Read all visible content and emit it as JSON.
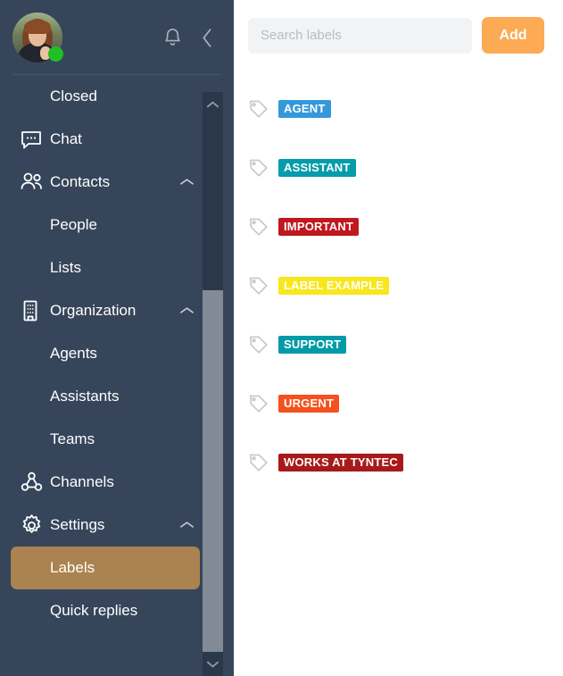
{
  "sidebar": {
    "avatar": {
      "name": "user-avatar",
      "status": "online"
    },
    "header_icons": [
      {
        "name": "notifications-bell-icon",
        "glyph": "bell"
      },
      {
        "name": "collapse-sidebar-icon",
        "glyph": "chevron-left"
      }
    ],
    "items": [
      {
        "label": "Closed",
        "icon": "none",
        "level": "sub",
        "chevron": "",
        "active": false
      },
      {
        "label": "Chat",
        "icon": "chat-icon",
        "level": "top",
        "chevron": "",
        "active": false
      },
      {
        "label": "Contacts",
        "icon": "contacts-icon",
        "level": "top",
        "chevron": "up",
        "active": false
      },
      {
        "label": "People",
        "icon": "none",
        "level": "sub",
        "chevron": "",
        "active": false
      },
      {
        "label": "Lists",
        "icon": "none",
        "level": "sub",
        "chevron": "",
        "active": false
      },
      {
        "label": "Organization",
        "icon": "building-icon",
        "level": "top",
        "chevron": "up",
        "active": false
      },
      {
        "label": "Agents",
        "icon": "none",
        "level": "sub",
        "chevron": "",
        "active": false
      },
      {
        "label": "Assistants",
        "icon": "none",
        "level": "sub",
        "chevron": "",
        "active": false
      },
      {
        "label": "Teams",
        "icon": "none",
        "level": "sub",
        "chevron": "",
        "active": false
      },
      {
        "label": "Channels",
        "icon": "channels-icon",
        "level": "top",
        "chevron": "",
        "active": false
      },
      {
        "label": "Settings",
        "icon": "gear-icon",
        "level": "top",
        "chevron": "up",
        "active": false
      },
      {
        "label": "Labels",
        "icon": "none",
        "level": "sub",
        "chevron": "",
        "active": true
      },
      {
        "label": "Quick replies",
        "icon": "none",
        "level": "sub",
        "chevron": "",
        "active": false
      }
    ],
    "scrollbar": {
      "up_arrow": "scroll-up-icon",
      "down_arrow": "scroll-down-icon"
    },
    "colors": {
      "background": "#36455a",
      "active_item": "#ab8350"
    }
  },
  "main": {
    "search": {
      "placeholder": "Search labels",
      "value": ""
    },
    "add_label": "Add",
    "add_button_color": "#fcaa54",
    "labels": [
      {
        "text": "AGENT",
        "color": "#3498db"
      },
      {
        "text": "ASSISTANT",
        "color": "#049caa"
      },
      {
        "text": "IMPORTANT",
        "color": "#c0181f"
      },
      {
        "text": "LABEL EXAMPLE",
        "color": "#f8e71c"
      },
      {
        "text": "SUPPORT",
        "color": "#039aa7"
      },
      {
        "text": "URGENT",
        "color": "#f5511e"
      },
      {
        "text": "WORKS AT TYNTEC",
        "color": "#a81a1a"
      }
    ]
  }
}
